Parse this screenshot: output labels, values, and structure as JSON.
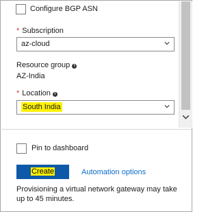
{
  "form": {
    "bgp_label": "Configure BGP ASN",
    "subscription_label": "Subscription",
    "subscription_value": "az-cloud",
    "resource_group_label": "Resource group",
    "resource_group_value": "AZ-India",
    "location_label": "Location",
    "location_value": "South India",
    "required_mark": "*",
    "info_glyph": "i"
  },
  "footer": {
    "pin_label": "Pin to dashboard",
    "create_label": "Create",
    "automation_label": "Automation options",
    "note": "Provisioning a virtual network gateway may take up to 45 minutes."
  },
  "colors": {
    "accent": "#0f5aa8",
    "link": "#0b6ccb",
    "highlight": "#fff200",
    "required": "#d13438"
  }
}
